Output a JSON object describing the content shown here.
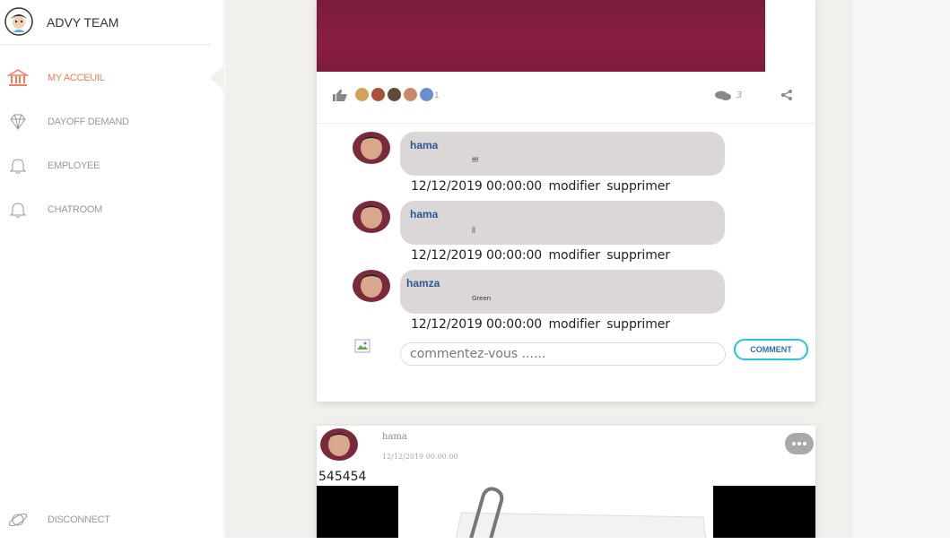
{
  "brand": {
    "name": "ADVY TEAM"
  },
  "sidebar": {
    "items": [
      {
        "label": "MY ACCEUIL",
        "icon": "bank-icon",
        "active": true
      },
      {
        "label": "DAYOFF DEMAND",
        "icon": "diamond-icon",
        "active": false
      },
      {
        "label": "EMPLOYEE",
        "icon": "bell-icon",
        "active": false
      },
      {
        "label": "CHATROOM",
        "icon": "bell-icon",
        "active": false
      }
    ],
    "disconnect": {
      "label": "DISCONNECT",
      "icon": "planet-icon"
    }
  },
  "post1": {
    "like_count": "1",
    "comment_count": "3",
    "comments": [
      {
        "author": "hama",
        "text": "fff",
        "date": "12/12/2019 00:00:00",
        "edit": "modifier",
        "delete": "supprimer"
      },
      {
        "author": "hama",
        "text": "jj",
        "date": "12/12/2019 00:00:00",
        "edit": "modifier",
        "delete": "supprimer"
      },
      {
        "author": "hamza",
        "text": "Green",
        "date": "12/12/2019 00:00:00",
        "edit": "modifier",
        "delete": "supprimer"
      }
    ],
    "comment_input": {
      "placeholder": "commentez-vous ......"
    },
    "comment_button": "COMMENT"
  },
  "post2": {
    "author": "hama",
    "date": "12/12/2019 00:00:00",
    "text": "545454"
  },
  "colors": {
    "accent": "#f47c5a",
    "author_link": "#2b5797",
    "button_border": "#27c3d6",
    "bubble": "#dbd7d7",
    "main_bg": "#f1f0ed"
  }
}
